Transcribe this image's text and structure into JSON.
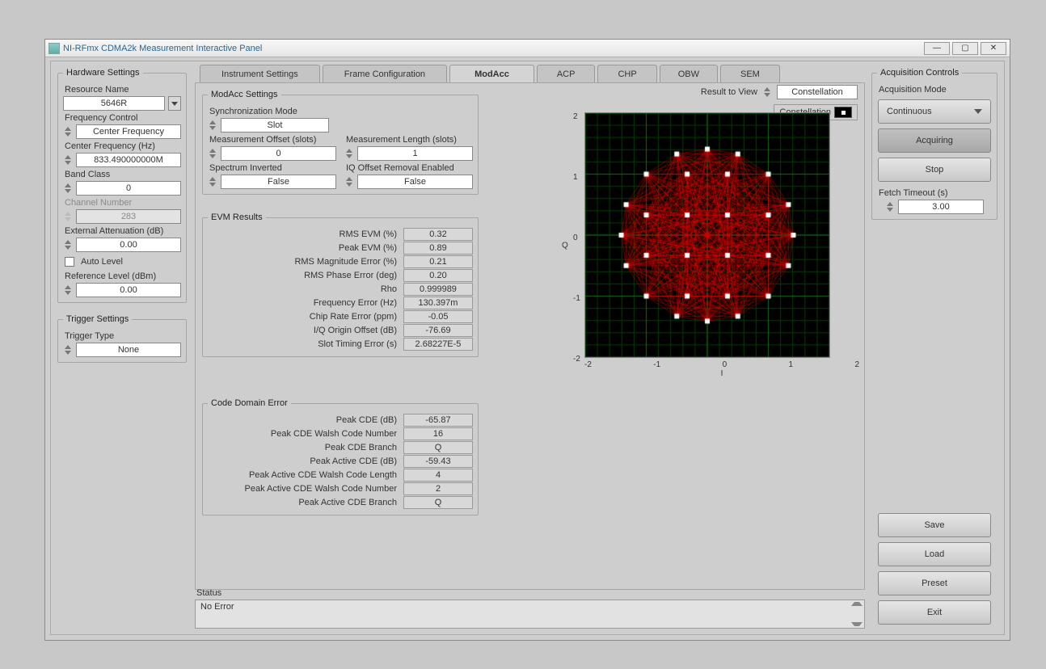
{
  "window": {
    "title": "NI-RFmx CDMA2k Measurement Interactive Panel"
  },
  "hardware": {
    "legend": "Hardware Settings",
    "resource_name_lbl": "Resource Name",
    "resource_name": "5646R",
    "freq_ctrl_lbl": "Frequency Control",
    "freq_ctrl": "Center Frequency",
    "center_freq_lbl": "Center Frequency (Hz)",
    "center_freq": "833.490000000M",
    "band_class_lbl": "Band Class",
    "band_class": "0",
    "channel_num_lbl": "Channel Number",
    "channel_num": "283",
    "ext_atten_lbl": "External Attenuation (dB)",
    "ext_atten": "0.00",
    "auto_level_lbl": "Auto Level",
    "ref_level_lbl": "Reference Level (dBm)",
    "ref_level": "0.00"
  },
  "trigger": {
    "legend": "Trigger Settings",
    "type_lbl": "Trigger Type",
    "type": "None"
  },
  "tabs": {
    "instrument": "Instrument Settings",
    "frame": "Frame Configuration",
    "modacc": "ModAcc",
    "acp": "ACP",
    "chp": "CHP",
    "obw": "OBW",
    "sem": "SEM"
  },
  "modacc": {
    "legend": "ModAcc Settings",
    "sync_lbl": "Synchronization Mode",
    "sync": "Slot",
    "offset_lbl": "Measurement Offset (slots)",
    "offset": "0",
    "length_lbl": "Measurement Length (slots)",
    "length": "1",
    "spec_inv_lbl": "Spectrum Inverted",
    "spec_inv": "False",
    "iq_off_lbl": "IQ Offset Removal Enabled",
    "iq_off": "False"
  },
  "evm": {
    "legend": "EVM Results",
    "rows": [
      {
        "lbl": "RMS EVM (%)",
        "val": "0.32"
      },
      {
        "lbl": "Peak EVM (%)",
        "val": "0.89"
      },
      {
        "lbl": "RMS Magnitude Error (%)",
        "val": "0.21"
      },
      {
        "lbl": "RMS Phase Error (deg)",
        "val": "0.20"
      },
      {
        "lbl": "Rho",
        "val": "0.999989"
      },
      {
        "lbl": "Frequency Error (Hz)",
        "val": "130.397m"
      },
      {
        "lbl": "Chip Rate Error (ppm)",
        "val": "-0.05"
      },
      {
        "lbl": "I/Q Origin Offset (dB)",
        "val": "-76.69"
      },
      {
        "lbl": "Slot Timing Error (s)",
        "val": "2.68227E-5"
      }
    ]
  },
  "cde": {
    "legend": "Code Domain Error",
    "rows": [
      {
        "lbl": "Peak CDE (dB)",
        "val": "-65.87"
      },
      {
        "lbl": "Peak CDE Walsh Code Number",
        "val": "16"
      },
      {
        "lbl": "Peak CDE Branch",
        "val": "Q"
      },
      {
        "lbl": "Peak Active CDE (dB)",
        "val": "-59.43"
      },
      {
        "lbl": "Peak Active CDE Walsh Code Length",
        "val": "4"
      },
      {
        "lbl": "Peak Active CDE Walsh Code Number",
        "val": "2"
      },
      {
        "lbl": "Peak Active CDE Branch",
        "val": "Q"
      }
    ]
  },
  "chart": {
    "result_view_lbl": "Result to View",
    "result_view": "Constellation",
    "legend_name": "Constellation",
    "xlabel": "I",
    "ylabel": "Q",
    "range": [
      -2,
      2
    ],
    "ticks": [
      "-2",
      "-1",
      "0",
      "1",
      "2"
    ]
  },
  "chart_data": {
    "type": "scatter",
    "title": "Constellation",
    "xlabel": "I",
    "ylabel": "Q",
    "xlim": [
      -2,
      2
    ],
    "ylim": [
      -2,
      2
    ],
    "points": [
      [
        -1.0,
        -1.0
      ],
      [
        -0.33,
        -1.0
      ],
      [
        0.33,
        -1.0
      ],
      [
        1.0,
        -1.0
      ],
      [
        -1.0,
        -0.33
      ],
      [
        -0.33,
        -0.33
      ],
      [
        0.33,
        -0.33
      ],
      [
        1.0,
        -0.33
      ],
      [
        -1.0,
        0.33
      ],
      [
        -0.33,
        0.33
      ],
      [
        0.33,
        0.33
      ],
      [
        1.0,
        0.33
      ],
      [
        -1.0,
        1.0
      ],
      [
        -0.33,
        1.0
      ],
      [
        0.33,
        1.0
      ],
      [
        1.0,
        1.0
      ],
      [
        0,
        1.41
      ],
      [
        0,
        -1.41
      ],
      [
        1.41,
        0
      ],
      [
        -1.41,
        0
      ],
      [
        0.5,
        1.33
      ],
      [
        -0.5,
        1.33
      ],
      [
        0.5,
        -1.33
      ],
      [
        -0.5,
        -1.33
      ],
      [
        1.33,
        0.5
      ],
      [
        1.33,
        -0.5
      ],
      [
        -1.33,
        0.5
      ],
      [
        -1.33,
        -0.5
      ]
    ],
    "edges": "dense"
  },
  "acq": {
    "legend": "Acquisition Controls",
    "mode_lbl": "Acquisition Mode",
    "mode": "Continuous",
    "acquiring": "Acquiring",
    "stop": "Stop",
    "fetch_lbl": "Fetch Timeout (s)",
    "fetch": "3.00"
  },
  "buttons": {
    "save": "Save",
    "load": "Load",
    "preset": "Preset",
    "exit": "Exit"
  },
  "status": {
    "label": "Status",
    "text": "No Error"
  }
}
